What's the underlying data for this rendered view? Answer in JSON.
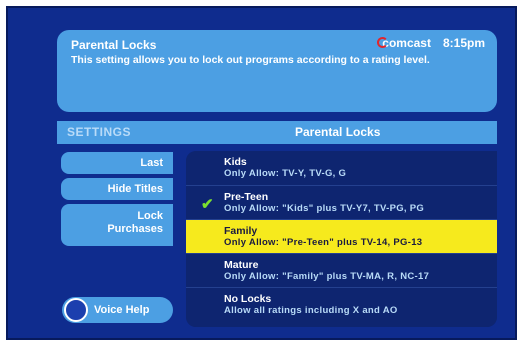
{
  "info": {
    "title": "Parental Locks",
    "description": "This setting allows you to lock out programs according to a rating level.",
    "brand": "comcast",
    "time": "8:15pm"
  },
  "header": {
    "settings_label": "SETTINGS",
    "panel_title": "Parental Locks"
  },
  "sidebar": {
    "last": "Last",
    "hide_titles": "Hide Titles",
    "lock": "Lock",
    "purchases": "Purchases",
    "voice_help": "Voice Help"
  },
  "options": [
    {
      "name": "Kids",
      "desc": "Only Allow:  TV-Y, TV-G, G"
    },
    {
      "name": "Pre-Teen",
      "desc": "Only Allow:  \"Kids\" plus TV-Y7, TV-PG, PG",
      "checked": true
    },
    {
      "name": "Family",
      "desc": "Only Allow:  \"Pre-Teen\" plus TV-14, PG-13",
      "selected": true
    },
    {
      "name": "Mature",
      "desc": "Only Allow: \"Family\" plus TV-MA, R, NC-17"
    },
    {
      "name": "No Locks",
      "desc": "Allow all ratings including X and AO"
    }
  ],
  "icons": {
    "check": "checkmark-icon",
    "voice": "voice-help-circle-icon"
  },
  "colors": {
    "background": "#0f2c8e",
    "accent": "#4c9fe3",
    "highlight": "#f6ea1d",
    "check": "#7cdf2f"
  }
}
